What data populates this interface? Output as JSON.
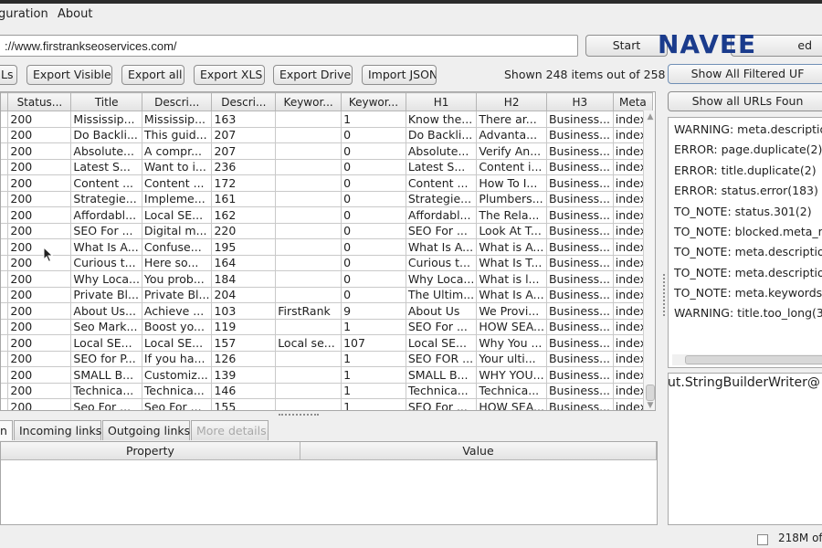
{
  "menu": {
    "configuration": "guration",
    "about": "About"
  },
  "url_bar": {
    "value": "://www.firstrankseoservices.com/"
  },
  "buttons": {
    "start": "Start",
    "stop_partial": "ed",
    "export_urls_partial": "Ls",
    "export_visible": "Export Visible",
    "export_all": "Export all",
    "export_xls": "Export XLS",
    "export_drive": "Export Drive",
    "import_json": "Import JSON",
    "show_all_filtered": "Show All Filtered UF",
    "show_all_urls_found": "Show all URLs Foun"
  },
  "logo": "NAVEE",
  "shown_count": "Shown 248 items out of 258",
  "table": {
    "columns": [
      "Status...",
      "Title",
      "Descri...",
      "Descri...",
      "Keywor...",
      "Keywor...",
      "H1",
      "H2",
      "H3",
      "Meta"
    ],
    "rows": [
      [
        "200",
        "Mississip...",
        "Mississip...",
        "163",
        "",
        "1",
        "Know the...",
        "There ar...",
        "Business...",
        "index,"
      ],
      [
        "200",
        "Do Backli...",
        "This guid...",
        "207",
        "",
        "0",
        "Do Backli...",
        "Advanta...",
        "Business...",
        "index,"
      ],
      [
        "200",
        "Absolute...",
        "A compr...",
        "207",
        "",
        "0",
        "Absolute...",
        "Verify An...",
        "Business...",
        "index,"
      ],
      [
        "200",
        "Latest S...",
        "Want to i...",
        "236",
        "",
        "0",
        "Latest S...",
        "Content i...",
        "Business...",
        "index,"
      ],
      [
        "200",
        "Content ...",
        "Content ...",
        "172",
        "",
        "0",
        "Content ...",
        "How To I...",
        "Business...",
        "index,"
      ],
      [
        "200",
        "Strategie...",
        "Impleme...",
        "161",
        "",
        "0",
        "Strategie...",
        "Plumbers...",
        "Business...",
        "index,"
      ],
      [
        "200",
        "Affordabl...",
        "Local SE...",
        "162",
        "",
        "0",
        "Affordabl...",
        "The Rela...",
        "Business...",
        "index,"
      ],
      [
        "200",
        "SEO For ...",
        "Digital m...",
        "220",
        "",
        "0",
        "SEO For ...",
        "Look At T...",
        "Business...",
        "index,"
      ],
      [
        "200",
        "What Is A...",
        "Confuse...",
        "195",
        "",
        "0",
        "What Is A...",
        "What is A...",
        "Business...",
        "index,"
      ],
      [
        "200",
        "Curious t...",
        "Here so...",
        "164",
        "",
        "0",
        "Curious t...",
        "What Is T...",
        "Business...",
        "index,"
      ],
      [
        "200",
        "Why Loca...",
        "You prob...",
        "184",
        "",
        "0",
        "Why Loca...",
        "What is l...",
        "Business...",
        "index,"
      ],
      [
        "200",
        "Private Bl...",
        "Private Bl...",
        "204",
        "",
        "0",
        "The Ultim...",
        "What Is A...",
        "Business...",
        "index,"
      ],
      [
        "200",
        "About Us...",
        "Achieve ...",
        "103",
        "FirstRank",
        "9",
        "About Us",
        "We Provi...",
        "Business...",
        "index,"
      ],
      [
        "200",
        "Seo Mark...",
        "Boost yo...",
        "119",
        "",
        "1",
        "SEO For ...",
        "HOW SEA...",
        "Business...",
        "index,"
      ],
      [
        "200",
        "Local SE...",
        "Local SE...",
        "157",
        "Local se...",
        "107",
        "Local SE...",
        "Why You ...",
        "Business...",
        "index,"
      ],
      [
        "200",
        "SEO for P...",
        "If you ha...",
        "126",
        "",
        "1",
        "SEO FOR ...",
        "Your ulti...",
        "Business...",
        "index,"
      ],
      [
        "200",
        "SMALL B...",
        "Customiz...",
        "139",
        "",
        "1",
        "SMALL B...",
        "WHY YOU...",
        "Business...",
        "index,"
      ],
      [
        "200",
        "Technica...",
        "Technica...",
        "146",
        "",
        "1",
        "Technica...",
        "Technica...",
        "Business...",
        "index,"
      ],
      [
        "200",
        "Seo For ...",
        "Seo For ...",
        "155",
        "",
        "1",
        "SEO For ...",
        "HOW SEA...",
        "Business...",
        "index,"
      ]
    ]
  },
  "tabs": [
    "n",
    "Incoming links",
    "Outgoing links",
    "More details"
  ],
  "props_table": {
    "property": "Property",
    "value": "Value"
  },
  "messages": [
    "WARNING: meta.description",
    "ERROR: page.duplicate(2)",
    "ERROR: title.duplicate(2)",
    "ERROR: status.error(183)",
    "TO_NOTE: status.301(2)",
    "TO_NOTE: blocked.meta_ro",
    "TO_NOTE: meta.description",
    "TO_NOTE: meta.description",
    "TO_NOTE: meta.keywords.p",
    "WARNING: title.too_long(32"
  ],
  "writer_text": "ut.StringBuilderWriter@",
  "memory": "218M of"
}
